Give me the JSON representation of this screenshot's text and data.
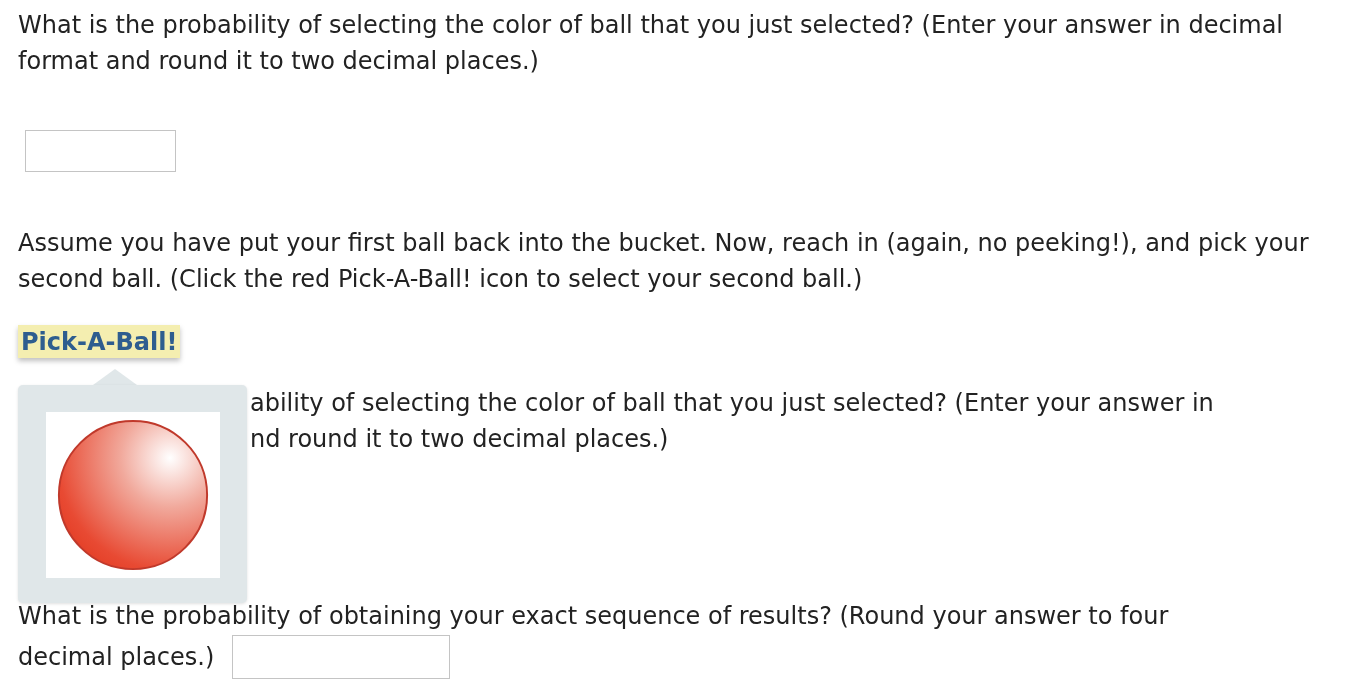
{
  "question_1": {
    "text": "What is the probability of selecting the color of ball that you just selected? (Enter your answer in decimal format and round it to two decimal places.)"
  },
  "instruction": {
    "text": "Assume you have put your first ball back into the bucket. Now, reach in (again, no peeking!), and pick your second ball. (Click the red Pick-A-Ball! icon to select your second ball.)"
  },
  "pick_button": {
    "label": "Pick-A-Ball!"
  },
  "popup": {
    "open": true
  },
  "question_2": {
    "lines": [
      "ability of selecting the color of ball that you just selected? (Enter your answer in",
      "nd round it to two decimal places.)"
    ]
  },
  "question_3": {
    "lines": [
      "What is the probability of obtaining your exact sequence of results? (Round your answer to four",
      "decimal places.)"
    ]
  }
}
